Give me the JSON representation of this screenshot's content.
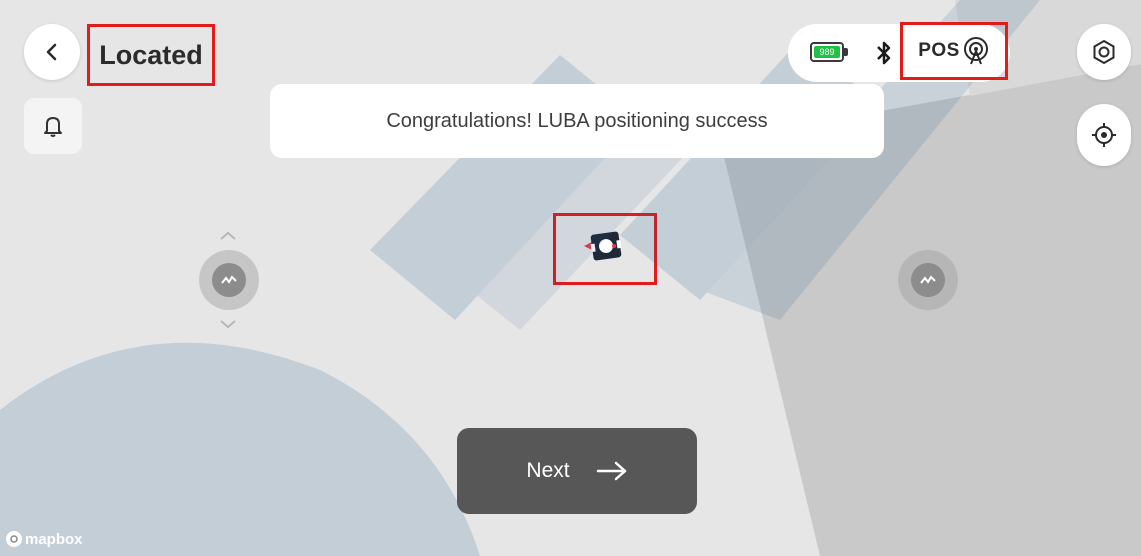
{
  "header": {
    "title": "Located"
  },
  "status": {
    "battery_level": "989",
    "pos_label": "POS"
  },
  "toast": {
    "message": "Congratulations! LUBA positioning success"
  },
  "actions": {
    "next_label": "Next"
  },
  "map": {
    "attribution": "mapbox"
  },
  "icons": {
    "back": "back-arrow-icon",
    "bell": "bell-icon",
    "battery": "battery-icon",
    "bluetooth": "bluetooth-icon",
    "antenna": "antenna-signal-icon",
    "settings": "settings-icon",
    "locate": "crosshair-icon",
    "mower": "mower-icon",
    "next_arrow": "arrow-right-icon"
  },
  "colors": {
    "highlight_box": "#e31b1b",
    "battery_green": "#23c047",
    "next_button_bg": "#575757",
    "watermark": "#1f5d91"
  }
}
